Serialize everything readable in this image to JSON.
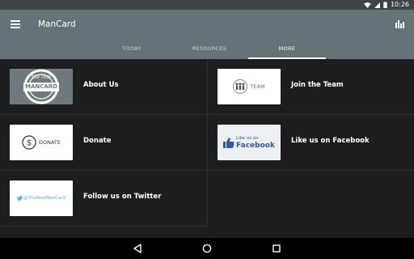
{
  "status_bar": {
    "time": "10:26"
  },
  "app_bar": {
    "title": "ManCard"
  },
  "tabs": [
    {
      "label": "TODAY",
      "active": false
    },
    {
      "label": "RESOURCES",
      "active": false
    },
    {
      "label": "MORE",
      "active": true
    }
  ],
  "items": [
    {
      "label": "About Us",
      "thumb": {
        "line1": "the real",
        "line2": "MANCARD"
      }
    },
    {
      "label": "Join the Team",
      "thumb": {
        "text": "TEAM"
      }
    },
    {
      "label": "Donate",
      "thumb": {
        "text": "DONATE"
      }
    },
    {
      "label": "Like us on Facebook",
      "thumb": {
        "line1": "Like us on",
        "line2": "Facebook"
      }
    },
    {
      "label": "Follow us on Twitter",
      "thumb": {
        "text": "@TheRealManCard"
      }
    }
  ],
  "colors": {
    "app_bar": "#657378",
    "status_bar": "#3c4446",
    "background": "#1c1d1f",
    "about_thumb_bg": "#6e7a7e",
    "twitter_blue": "#55acee",
    "facebook_blue": "#3b5998"
  },
  "icons": [
    "wifi-icon",
    "signal-icon",
    "battery-icon",
    "menu-icon",
    "stats-icon",
    "back-icon",
    "home-icon",
    "recents-icon",
    "team-people-icon",
    "dollar-icon",
    "thumbs-up-icon",
    "twitter-bird-icon"
  ]
}
